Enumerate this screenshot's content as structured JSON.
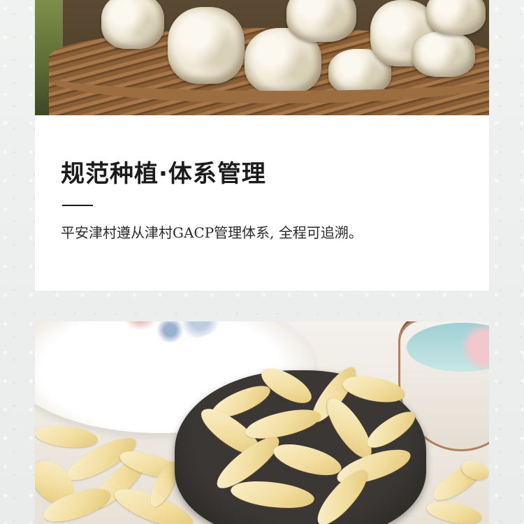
{
  "section": {
    "title": "规范种植·体系管理",
    "description": "平安津村遵从津村GACP管理体系, 全程可追溯。"
  }
}
